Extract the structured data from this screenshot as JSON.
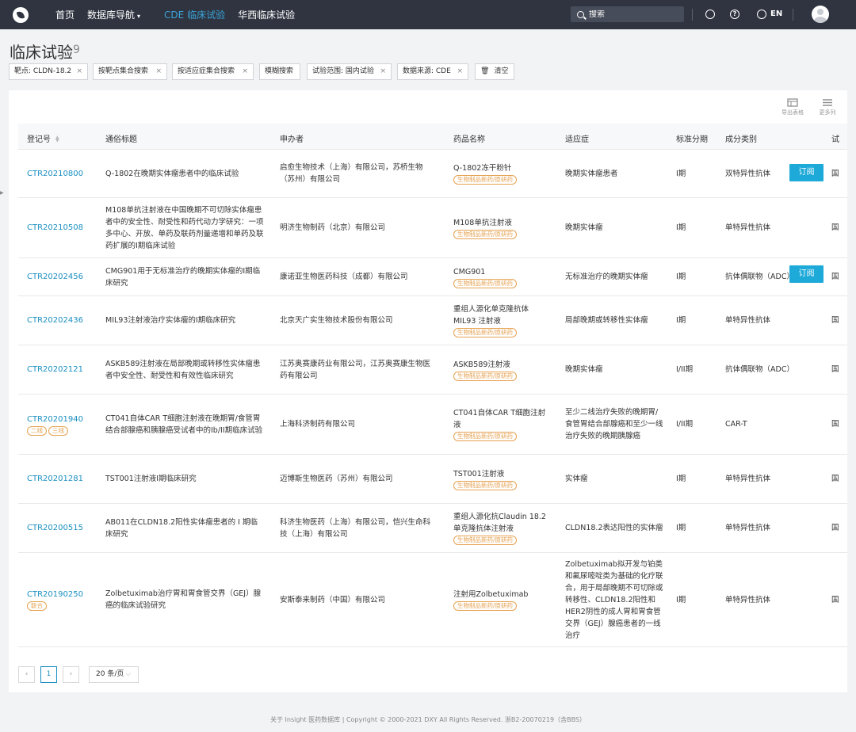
{
  "nav": {
    "items": [
      "首页",
      "数据库导航",
      "CDE 临床试验",
      "华西临床试验"
    ],
    "search_placeholder": "搜索",
    "lang": "EN"
  },
  "page": {
    "title": "临床试验",
    "count": "9"
  },
  "filters": [
    "靶点: CLDN-18.2",
    "按靶点集合搜索",
    "按适应症集合搜索",
    "模糊搜索",
    "试验范围: 国内试验",
    "数据来源: CDE",
    "清空"
  ],
  "tools": {
    "export": "导出表格",
    "more": "更多列"
  },
  "columns": [
    "登记号",
    "通俗标题",
    "申办者",
    "药品名称",
    "适应症",
    "标准分期",
    "成分类别",
    "试"
  ],
  "subscribe_label": "订阅",
  "rows": [
    {
      "reg": "CTR20210800",
      "tags": [],
      "title": "Q-1802在晚期实体瘤患者中的临床试验",
      "sponsor": "启愈生物技术（上海）有限公司，苏桥生物（苏州）有限公司",
      "drug": "Q-1802冻干粉针",
      "drug_tag": "生物制品新药/原研药",
      "indication": "晚期实体瘤患者",
      "phase": "I期",
      "category": "双特异性抗体",
      "extra": "国",
      "subscribe": true
    },
    {
      "reg": "CTR20210508",
      "tags": [],
      "title": "M108单抗注射液在中国晚期不可切除实体瘤患者中的安全性、耐受性和药代动力学研究：一项多中心、开放、单药及联药剂量递增和单药及联药扩展的I期临床试验",
      "sponsor": "明济生物制药（北京）有限公司",
      "drug": "M108单抗注射液",
      "drug_tag": "生物制品新药/原研药",
      "indication": "晚期实体瘤",
      "phase": "I期",
      "category": "单特异性抗体",
      "extra": "国",
      "subscribe": false
    },
    {
      "reg": "CTR20202456",
      "tags": [],
      "title": "CMG901用于无标准治疗的晚期实体瘤的I期临床研究",
      "sponsor": "康诺亚生物医药科技（成都）有限公司",
      "drug": "CMG901",
      "drug_tag": "生物制品新药/原研药",
      "indication": "无标准治疗的晚期实体瘤",
      "phase": "I期",
      "category": "抗体偶联物（ADC）",
      "extra": "国",
      "subscribe": true
    },
    {
      "reg": "CTR20202436",
      "tags": [],
      "title": "MIL93注射液治疗实体瘤的I期临床研究",
      "sponsor": "北京天广实生物技术股份有限公司",
      "drug": "重组人源化单克隆抗体 MIL93 注射液",
      "drug_tag": "生物制品新药/原研药",
      "indication": "局部晚期或转移性实体瘤",
      "phase": "I期",
      "category": "单特异性抗体",
      "extra": "国",
      "subscribe": false
    },
    {
      "reg": "CTR20202121",
      "tags": [],
      "title": "ASKB589注射液在局部晚期或转移性实体瘤患者中安全性、耐受性和有效性临床研究",
      "sponsor": "江苏奥赛康药业有限公司，江苏奥赛康生物医药有限公司",
      "drug": "ASKB589注射液",
      "drug_tag": "生物制品新药/原研药",
      "indication": "晚期实体瘤",
      "phase": "I/II期",
      "category": "抗体偶联物（ADC）",
      "extra": "国",
      "subscribe": false
    },
    {
      "reg": "CTR20201940",
      "tags": [
        "二线",
        "三线"
      ],
      "title": "CT041自体CAR T细胞注射液在晚期胃/食管胃结合部腺癌和胰腺癌受试者中的Ib/II期临床试验",
      "sponsor": "上海科济制药有限公司",
      "drug": "CT041自体CAR T细胞注射液",
      "drug_tag": "生物制品新药/原研药",
      "indication": "至少二线治疗失败的晚期胃/食管胃结合部腺癌和至少一线治疗失败的晚期胰腺癌",
      "phase": "I/II期",
      "category": "CAR-T",
      "extra": "国",
      "subscribe": false
    },
    {
      "reg": "CTR20201281",
      "tags": [],
      "title": "TST001注射液I期临床研究",
      "sponsor": "迈博斯生物医药（苏州）有限公司",
      "drug": "TST001注射液",
      "drug_tag": "生物制品新药/原研药",
      "indication": "实体瘤",
      "phase": "I期",
      "category": "单特异性抗体",
      "extra": "国",
      "subscribe": false
    },
    {
      "reg": "CTR20200515",
      "tags": [],
      "title": "AB011在CLDN18.2阳性实体瘤患者的 I 期临床研究",
      "sponsor": "科济生物医药（上海）有限公司，恺兴生命科技（上海）有限公司",
      "drug": "重组人源化抗Claudin 18.2单克隆抗体注射液",
      "drug_tag": "生物制品新药/原研药",
      "indication": "CLDN18.2表达阳性的实体瘤",
      "phase": "I期",
      "category": "单特异性抗体",
      "extra": "国",
      "subscribe": false
    },
    {
      "reg": "CTR20190250",
      "tags": [
        "联合"
      ],
      "title": "Zolbetuximab治疗胃和胃食管交界（GEJ）腺癌的临床试验研究",
      "sponsor": "安斯泰来制药（中国）有限公司",
      "drug": "注射用Zolbetuximab",
      "drug_tag": "生物制品新药/原研药",
      "indication": "Zolbetuximab拟开发与铂类和氟尿嘧啶类为基础的化疗联合，用于局部晚期不可切除或转移性、CLDN18.2阳性和HER2阴性的成人胃和胃食管交界（GEJ）腺癌患者的一线治疗",
      "phase": "I期",
      "category": "单特异性抗体",
      "extra": "国",
      "subscribe": false
    }
  ],
  "pagination": {
    "prev": "‹",
    "current": "1",
    "next": "›",
    "page_size": "20 条/页"
  },
  "footer": "关于 Insight 医药数据库 | Copyright © 2000-2021 DXY All Rights Reserved. 浙B2-20070219（含BBS）"
}
